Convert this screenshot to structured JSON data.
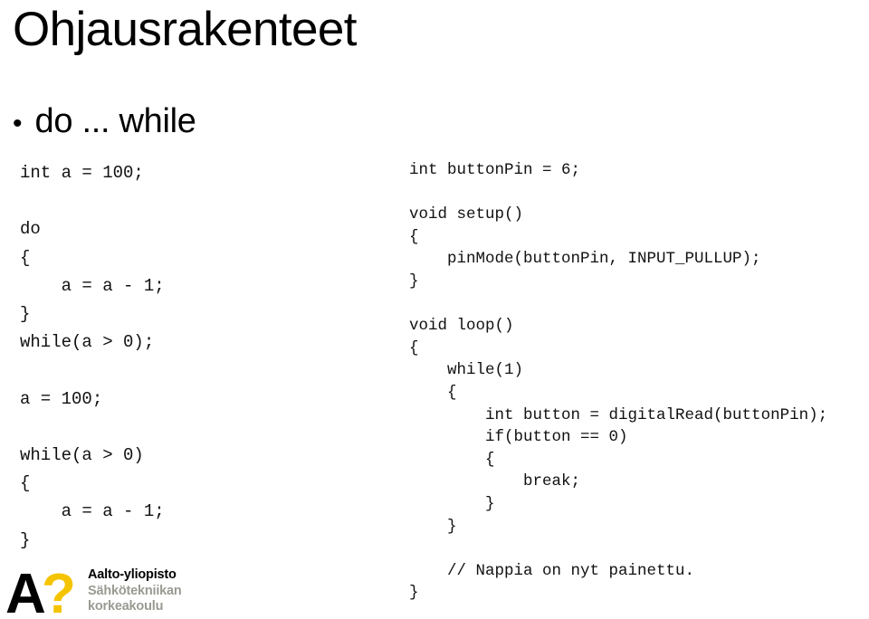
{
  "slide": {
    "title": "Ohjausrakenteet",
    "background_color": "#ffffff",
    "text_color": "#000000"
  },
  "bullet": {
    "marker": "•",
    "text": "do ... while"
  },
  "code_left": {
    "language": "c",
    "lines": [
      "int a = 100;",
      "",
      "do",
      "{",
      "    a = a - 1;",
      "}",
      "while(a > 0);",
      "",
      "a = 100;",
      "",
      "while(a > 0)",
      "{",
      "    a = a - 1;",
      "}"
    ]
  },
  "code_right": {
    "language": "arduino",
    "lines": [
      "int buttonPin = 6;",
      "",
      "void setup()",
      "{",
      "    pinMode(buttonPin, INPUT_PULLUP);",
      "}",
      "",
      "void loop()",
      "{",
      "    while(1)",
      "    {",
      "        int button = digitalRead(buttonPin);",
      "        if(button == 0)",
      "        {",
      "            break;",
      "        }",
      "    }",
      "",
      "    // Nappia on nyt painettu.",
      "}"
    ]
  },
  "logo": {
    "mark_letter": "A",
    "mark_symbol": "?",
    "mark_letter_color": "#000000",
    "mark_symbol_color": "#f5c400",
    "line1": "Aalto-yliopisto",
    "line2": "Sähkötekniikan",
    "line3": "korkeakoulu",
    "line1_color": "#000000",
    "line2_color": "#9a9a93"
  }
}
